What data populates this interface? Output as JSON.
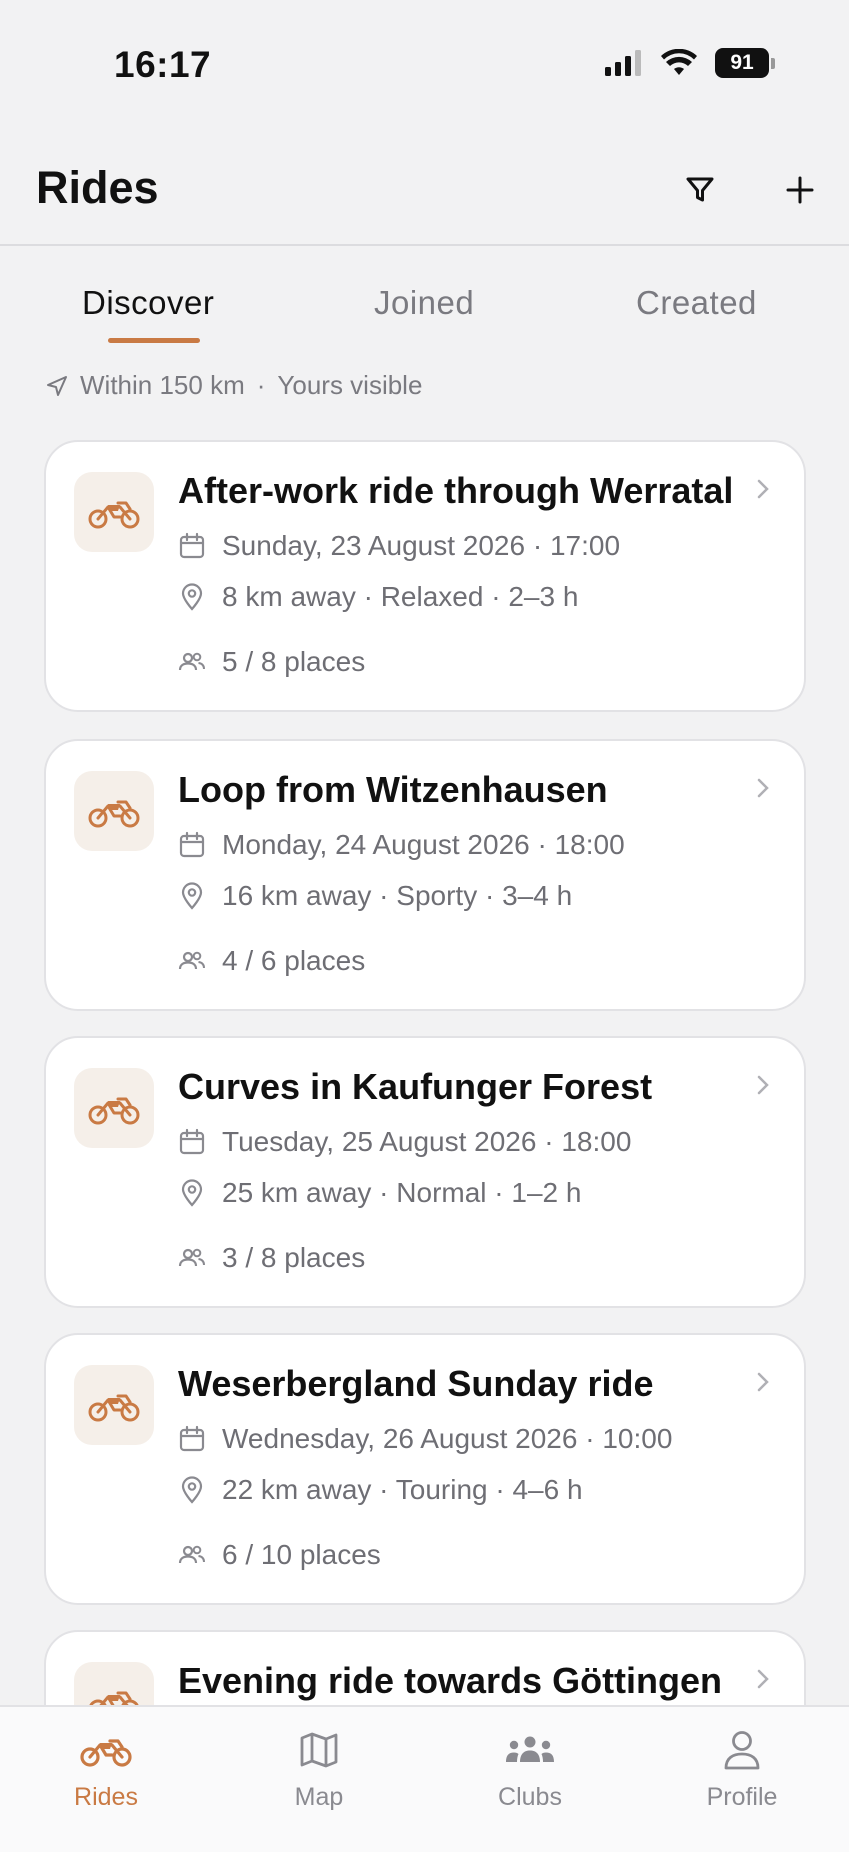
{
  "status_bar": {
    "time": "16:17",
    "battery": "91"
  },
  "header": {
    "title": "Rides"
  },
  "tabs": [
    {
      "label": "Discover",
      "active": true
    },
    {
      "label": "Joined",
      "active": false
    },
    {
      "label": "Created",
      "active": false
    }
  ],
  "location_filter": {
    "radius": "Within 150 km",
    "separator": "·",
    "visibility": "Yours visible"
  },
  "rides": [
    {
      "title": "After-work ride through Werratal",
      "date": "Sunday, 23 August 2026 · 17:00",
      "meta": "8 km away · Relaxed · 2–3 h",
      "places": "5 / 8 places"
    },
    {
      "title": "Loop from Witzenhausen",
      "date": "Monday, 24 August 2026 · 18:00",
      "meta": "16 km away · Sporty · 3–4 h",
      "places": "4 / 6 places"
    },
    {
      "title": "Curves in Kaufunger Forest",
      "date": "Tuesday, 25 August 2026 · 18:00",
      "meta": "25 km away · Normal · 1–2 h",
      "places": "3 / 8 places"
    },
    {
      "title": "Weserbergland Sunday ride",
      "date": "Wednesday, 26 August 2026 · 10:00",
      "meta": "22 km away · Touring · 4–6 h",
      "places": "6 / 10 places"
    },
    {
      "title": "Evening ride towards Göttingen",
      "date": "",
      "meta": "",
      "places": ""
    }
  ],
  "tabbar": [
    {
      "label": "Rides",
      "icon": "motorcycle-icon",
      "active": true
    },
    {
      "label": "Map",
      "icon": "map-icon",
      "active": false
    },
    {
      "label": "Clubs",
      "icon": "group-icon",
      "active": false
    },
    {
      "label": "Profile",
      "icon": "person-icon",
      "active": false
    }
  ],
  "colors": {
    "accent": "#c97a44",
    "background": "#f2f2f3",
    "card": "#ffffff",
    "muted": "#6e6e74"
  }
}
